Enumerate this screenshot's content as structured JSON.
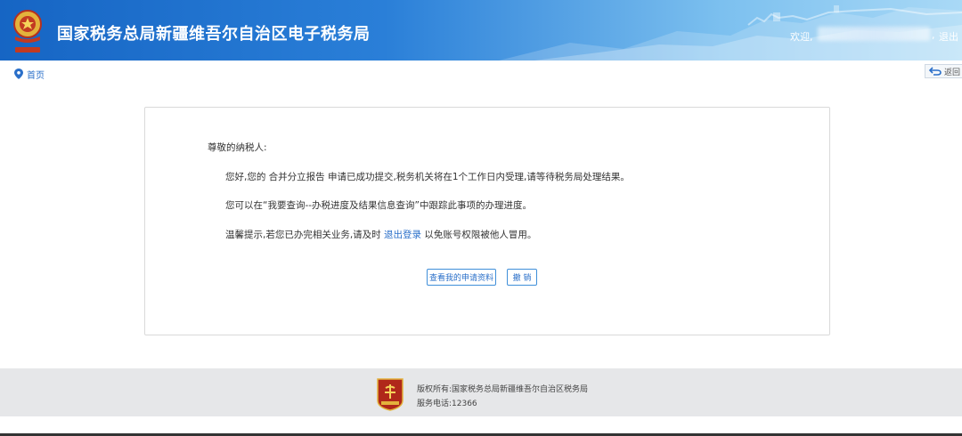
{
  "header": {
    "site_title": "国家税务总局新疆维吾尔自治区电子税务局",
    "welcome_label": "欢迎,",
    "separator": ",",
    "logout_label": "退出"
  },
  "breadcrumb": {
    "home_label": "首页"
  },
  "back_button": {
    "label": "返回"
  },
  "notice": {
    "salutation": "尊敬的纳税人:",
    "line1": "您好,您的 合并分立报告 申请已成功提交,税务机关将在1个工作日内受理,请等待税务局处理结果。",
    "line2": "您可以在“我要查询--办税进度及结果信息查询”中跟踪此事项的办理进度。",
    "line3_prefix": "温馨提示,若您已办完相关业务,请及时 ",
    "line3_link": "退出登录",
    "line3_suffix": " 以免账号权限被他人冒用。"
  },
  "actions": {
    "view_label": "查看我的申请资料",
    "cancel_label": "撤 销"
  },
  "footer": {
    "copyright": "版权所有:国家税务总局新疆维吾尔自治区税务局",
    "phone": "服务电话:12366"
  },
  "colors": {
    "header_blue": "#1665c4",
    "link_blue": "#2a6fc9",
    "footer_gray": "#e6e7e9"
  }
}
